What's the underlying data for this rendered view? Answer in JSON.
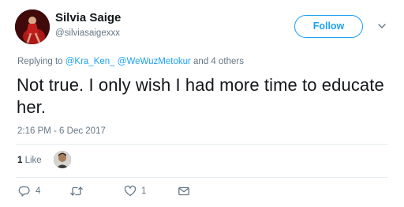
{
  "author": {
    "name": "Silvia Saige",
    "handle": "@silviasaigexxx",
    "avatar_icon": "profile-avatar"
  },
  "follow_button": {
    "label": "Follow"
  },
  "menu_icon": "chevron-down-icon",
  "reply_context": {
    "prefix": "Replying to ",
    "mentions": [
      "@Kra_Ken_",
      "@WeWuzMetokur"
    ],
    "suffix": " and 4 others"
  },
  "tweet": {
    "text": "Not true. I only wish I had more time to educate her.",
    "timestamp": "2:16 PM - 6 Dec 2017"
  },
  "stats": {
    "likes_count": "1",
    "likes_label": " Like"
  },
  "actions": {
    "reply_count": "4",
    "retweet_count": "",
    "like_count": "1"
  },
  "colors": {
    "accent": "#1da1f2",
    "secondary_text": "#657786",
    "primary_text": "#14171a",
    "divider": "#e6ecf0"
  }
}
